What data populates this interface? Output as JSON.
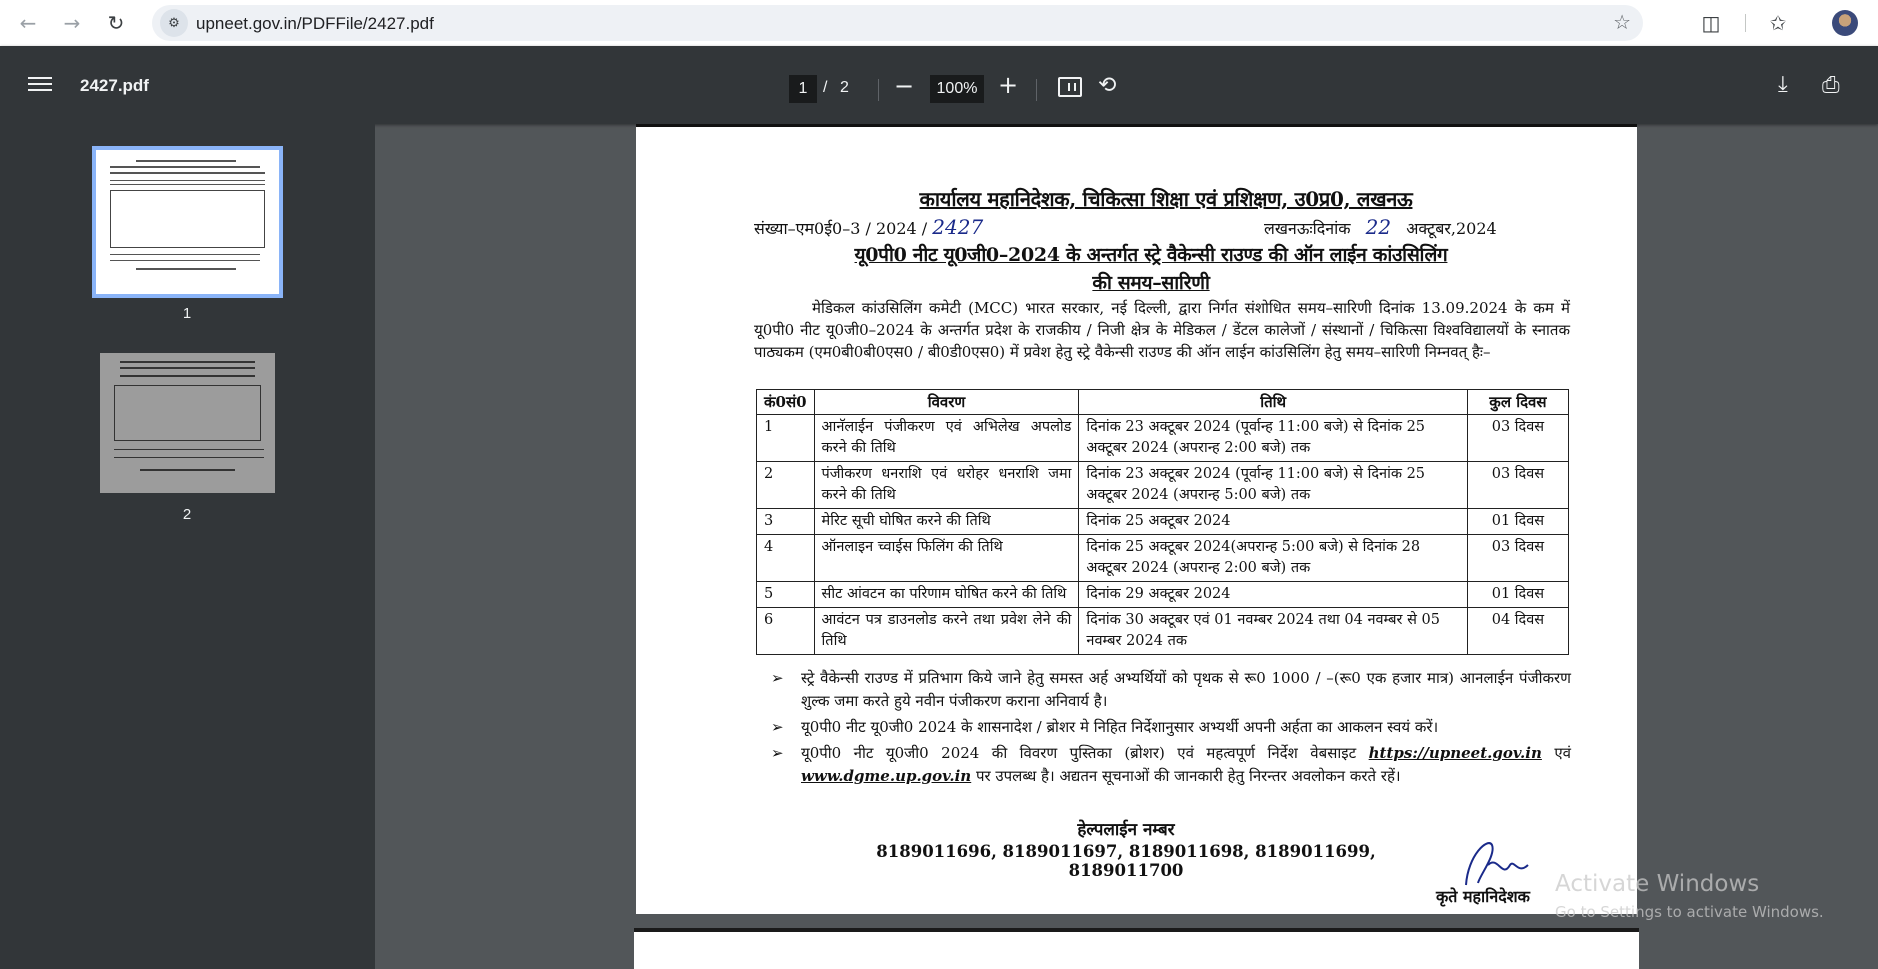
{
  "browser": {
    "url": "upneet.gov.in/PDFFile/2427.pdf",
    "icons": {
      "back": "arrow-left",
      "forward": "arrow-right",
      "reload": "reload",
      "site_info": "tune",
      "bookmark": "star",
      "extensions": "puzzle",
      "favorites": "star-list",
      "profile": "avatar"
    }
  },
  "viewer": {
    "doc_title": "2427.pdf",
    "current_page": "1",
    "page_separator": "/",
    "total_pages": "2",
    "zoom": "100%",
    "zoom_out_symbol": "−",
    "zoom_in_symbol": "+",
    "icons": {
      "menu": "hamburger",
      "fit": "fit-to-page",
      "rotate": "rotate",
      "download": "download",
      "print": "printer"
    }
  },
  "sidebar": {
    "thumbnails": [
      {
        "label": "1",
        "selected": true
      },
      {
        "label": "2",
        "selected": false
      }
    ]
  },
  "document": {
    "office_title": "कार्यालय महानिदेशक, चिकित्सा शिक्षा एवं प्रशिक्षण, उ0प्र0, लखनऊ",
    "ref_prefix": "संख्या–एम0ई0–3 / 2024 /",
    "ref_number": "2427",
    "date_prefix": "लखनऊःदिनांक",
    "date_day": "22",
    "date_suffix": "अक्टूबर,2024",
    "heading_line1": "यू0पी0 नीट यू0जी0–2024 के अन्तर्गत स्ट्रे वैकेन्सी राउण्ड की ऑन लाईन कांउसिलिंग",
    "heading_line2": "की समय–सारिणी",
    "intro": "मेडिकल कांउसिलिंग कमेटी (MCC) भारत सरकार, नई दिल्ली, द्वारा निर्गत संशोधित समय–सारिणी दिनांक 13.09.2024 के कम में यू0पी0 नीट यू0जी0–2024 के अन्तर्गत प्रदेश के राजकीय / निजी क्षेत्र के मेडिकल / डेंटल कालेजों / संस्थानों / चिकित्सा विश्वविद्यालयों के स्नातक पाठ्यकम (एम0बी0बी0एस0 / बी0डी0एस0) में प्रवेश हेतु स्ट्रे वैकेन्सी राउण्ड की ऑन लाईन कांउसिलिंग हेतु समय–सारिणी निम्नवत् हैः–",
    "table": {
      "headers": [
        "कं0सं0",
        "विवरण",
        "तिथि",
        "कुल दिवस"
      ],
      "rows": [
        {
          "no": "1",
          "desc": "आनॅलाईन पंजीकरण एवं अभिलेख अपलोड करने की तिथि",
          "date": "दिनांक 23 अक्टूबर 2024 (पूर्वान्ह 11:00 बजे) से दिनांक 25 अक्टूबर 2024 (अपरान्ह 2:00 बजे) तक",
          "days": "03 दिवस"
        },
        {
          "no": "2",
          "desc": "पंजीकरण धनराशि एवं धरोहर धनराशि जमा करने की तिथि",
          "date": "दिनांक 23 अक्टूबर 2024 (पूर्वान्ह 11:00 बजे) से दिनांक 25 अक्टूबर 2024 (अपरान्ह 5:00 बजे) तक",
          "days": "03 दिवस"
        },
        {
          "no": "3",
          "desc": "मेरिट सूची घोषित करने की तिथि",
          "date": "दिनांक 25 अक्टूबर 2024",
          "days": "01 दिवस"
        },
        {
          "no": "4",
          "desc": "ऑनलाइन च्वाईस फिलिंग की तिथि",
          "date": "दिनांक 25 अक्टूबर 2024(अपरान्ह 5:00 बजे) से दिनांक 28 अक्टूबर 2024 (अपरान्ह 2:00 बजे) तक",
          "days": "03 दिवस"
        },
        {
          "no": "5",
          "desc": "सीट आंवटन का परिणाम घोषित करने की तिथि",
          "date": "दिनांक 29 अक्टूबर 2024",
          "days": "01 दिवस"
        },
        {
          "no": "6",
          "desc": "आवंटन पत्र डाउनलोड करने तथा प्रवेश लेने की तिथि",
          "date": "दिनांक 30 अक्टूबर एवं 01 नवम्बर 2024 तथा 04 नवम्बर से 05 नवम्बर 2024 तक",
          "days": "04 दिवस"
        }
      ]
    },
    "notes": [
      {
        "text": "स्ट्रे वैकेन्सी राउण्ड में प्रतिभाग किये जाने हेतु समस्त अर्ह अभ्यर्थियों को पृथक से रू0 1000 / –(रू0 एक हजार मात्र) आनलाईन पंजीकरण शुल्क जमा करते हुये नवीन पंजीकरण कराना अनिवार्य है।"
      },
      {
        "text": "यू0पी0 नीट यू0जी0 2024 के शासनादेश / ब्रोशर मे निहित निर्देशानुसार अभ्यर्थी अपनी अर्हता का आकलन स्वयं करें।"
      }
    ],
    "note3_part1": "यू0पी0 नीट यू0जी0 2024 की विवरण पुस्तिका (ब्रोशर) एवं महत्वपूर्ण निर्देश वेबसाइट ",
    "note3_link1": "https://upneet.gov.in",
    "note3_part2": " एवं ",
    "note3_link2": "www.dgme.up.gov.in",
    "note3_part3": " पर उपलब्ध है। अद्यतन सूचनाओं की जानकारी हेतु निरन्तर अवलोकन करते रहें।",
    "note_marker": "➢",
    "helpline_title": "हेल्पलाईन नम्बर",
    "helpline_numbers": "8189011696, 8189011697, 8189011698, 8189011699, 8189011700",
    "signatory": "कृते महानिदेशक"
  },
  "os_watermark": {
    "line1": "Activate Windows",
    "line2": "Go to Settings to activate Windows."
  }
}
